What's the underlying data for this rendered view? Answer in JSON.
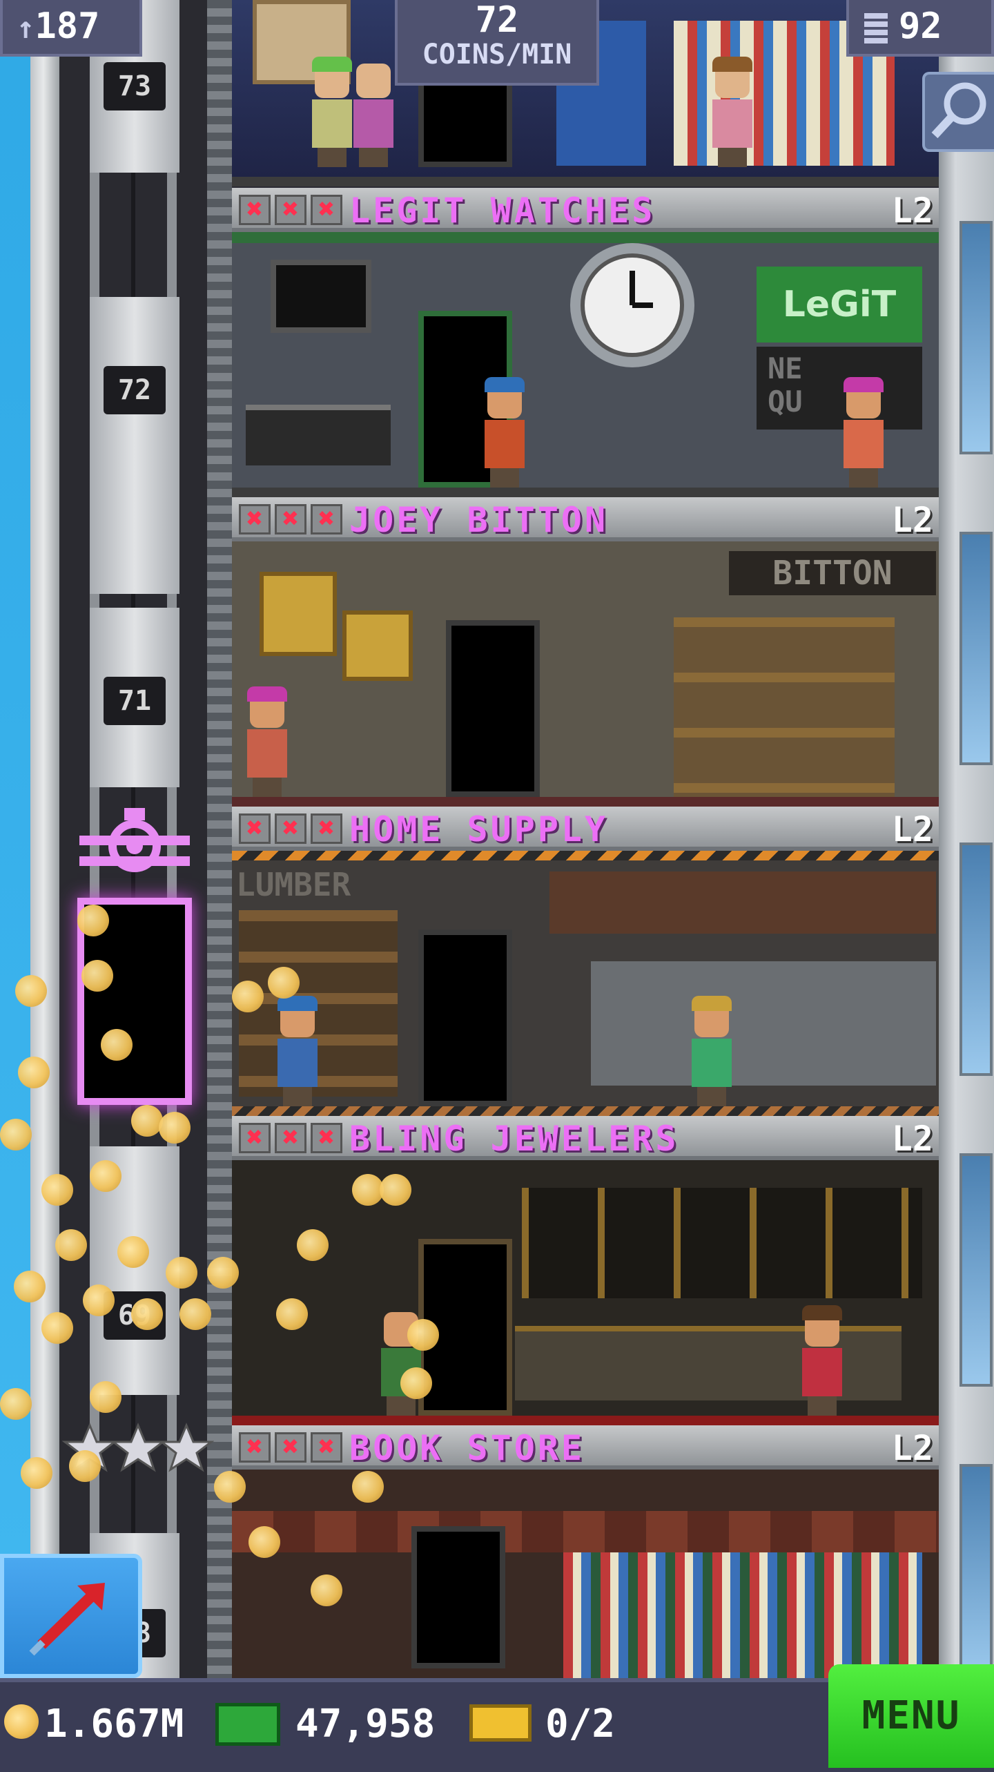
{
  "top_bar": {
    "population": "187",
    "coins_per_min_value": "72",
    "coins_per_min_label": "COINS/MIN",
    "floors_count": "92"
  },
  "elevator": {
    "floor_labels": [
      "73",
      "72",
      "71",
      "69",
      "68"
    ]
  },
  "floors": [
    {
      "name": "LEGIT WATCHES",
      "level": "L2",
      "sign_main": "LeGiT",
      "sign_sub": "NE\nQU"
    },
    {
      "name": "JOEY BITTON",
      "level": "L2",
      "sign_main": "BITTON"
    },
    {
      "name": "HOME SUPPLY",
      "level": "L2",
      "sign_main": "LUMBER"
    },
    {
      "name": "BLING JEWELERS",
      "level": "L2"
    },
    {
      "name": "BOOK STORE",
      "level": "L2"
    }
  ],
  "stock_marks": "✖",
  "bottom_bar": {
    "coins": "1.667M",
    "bux": "47,958",
    "tickets": "0/2",
    "menu_label": "MENU"
  },
  "colors": {
    "sky": "#41b8f0",
    "floor_name": "#ec6ff5",
    "menu_green": "#39d52c",
    "coin": "#f2c35a"
  },
  "icons": [
    "population-icon",
    "floors-icon",
    "search-icon",
    "coin-icon",
    "bux-icon",
    "ticket-icon",
    "move-arrow-icon",
    "vip-elevator-icon",
    "star-icon"
  ]
}
